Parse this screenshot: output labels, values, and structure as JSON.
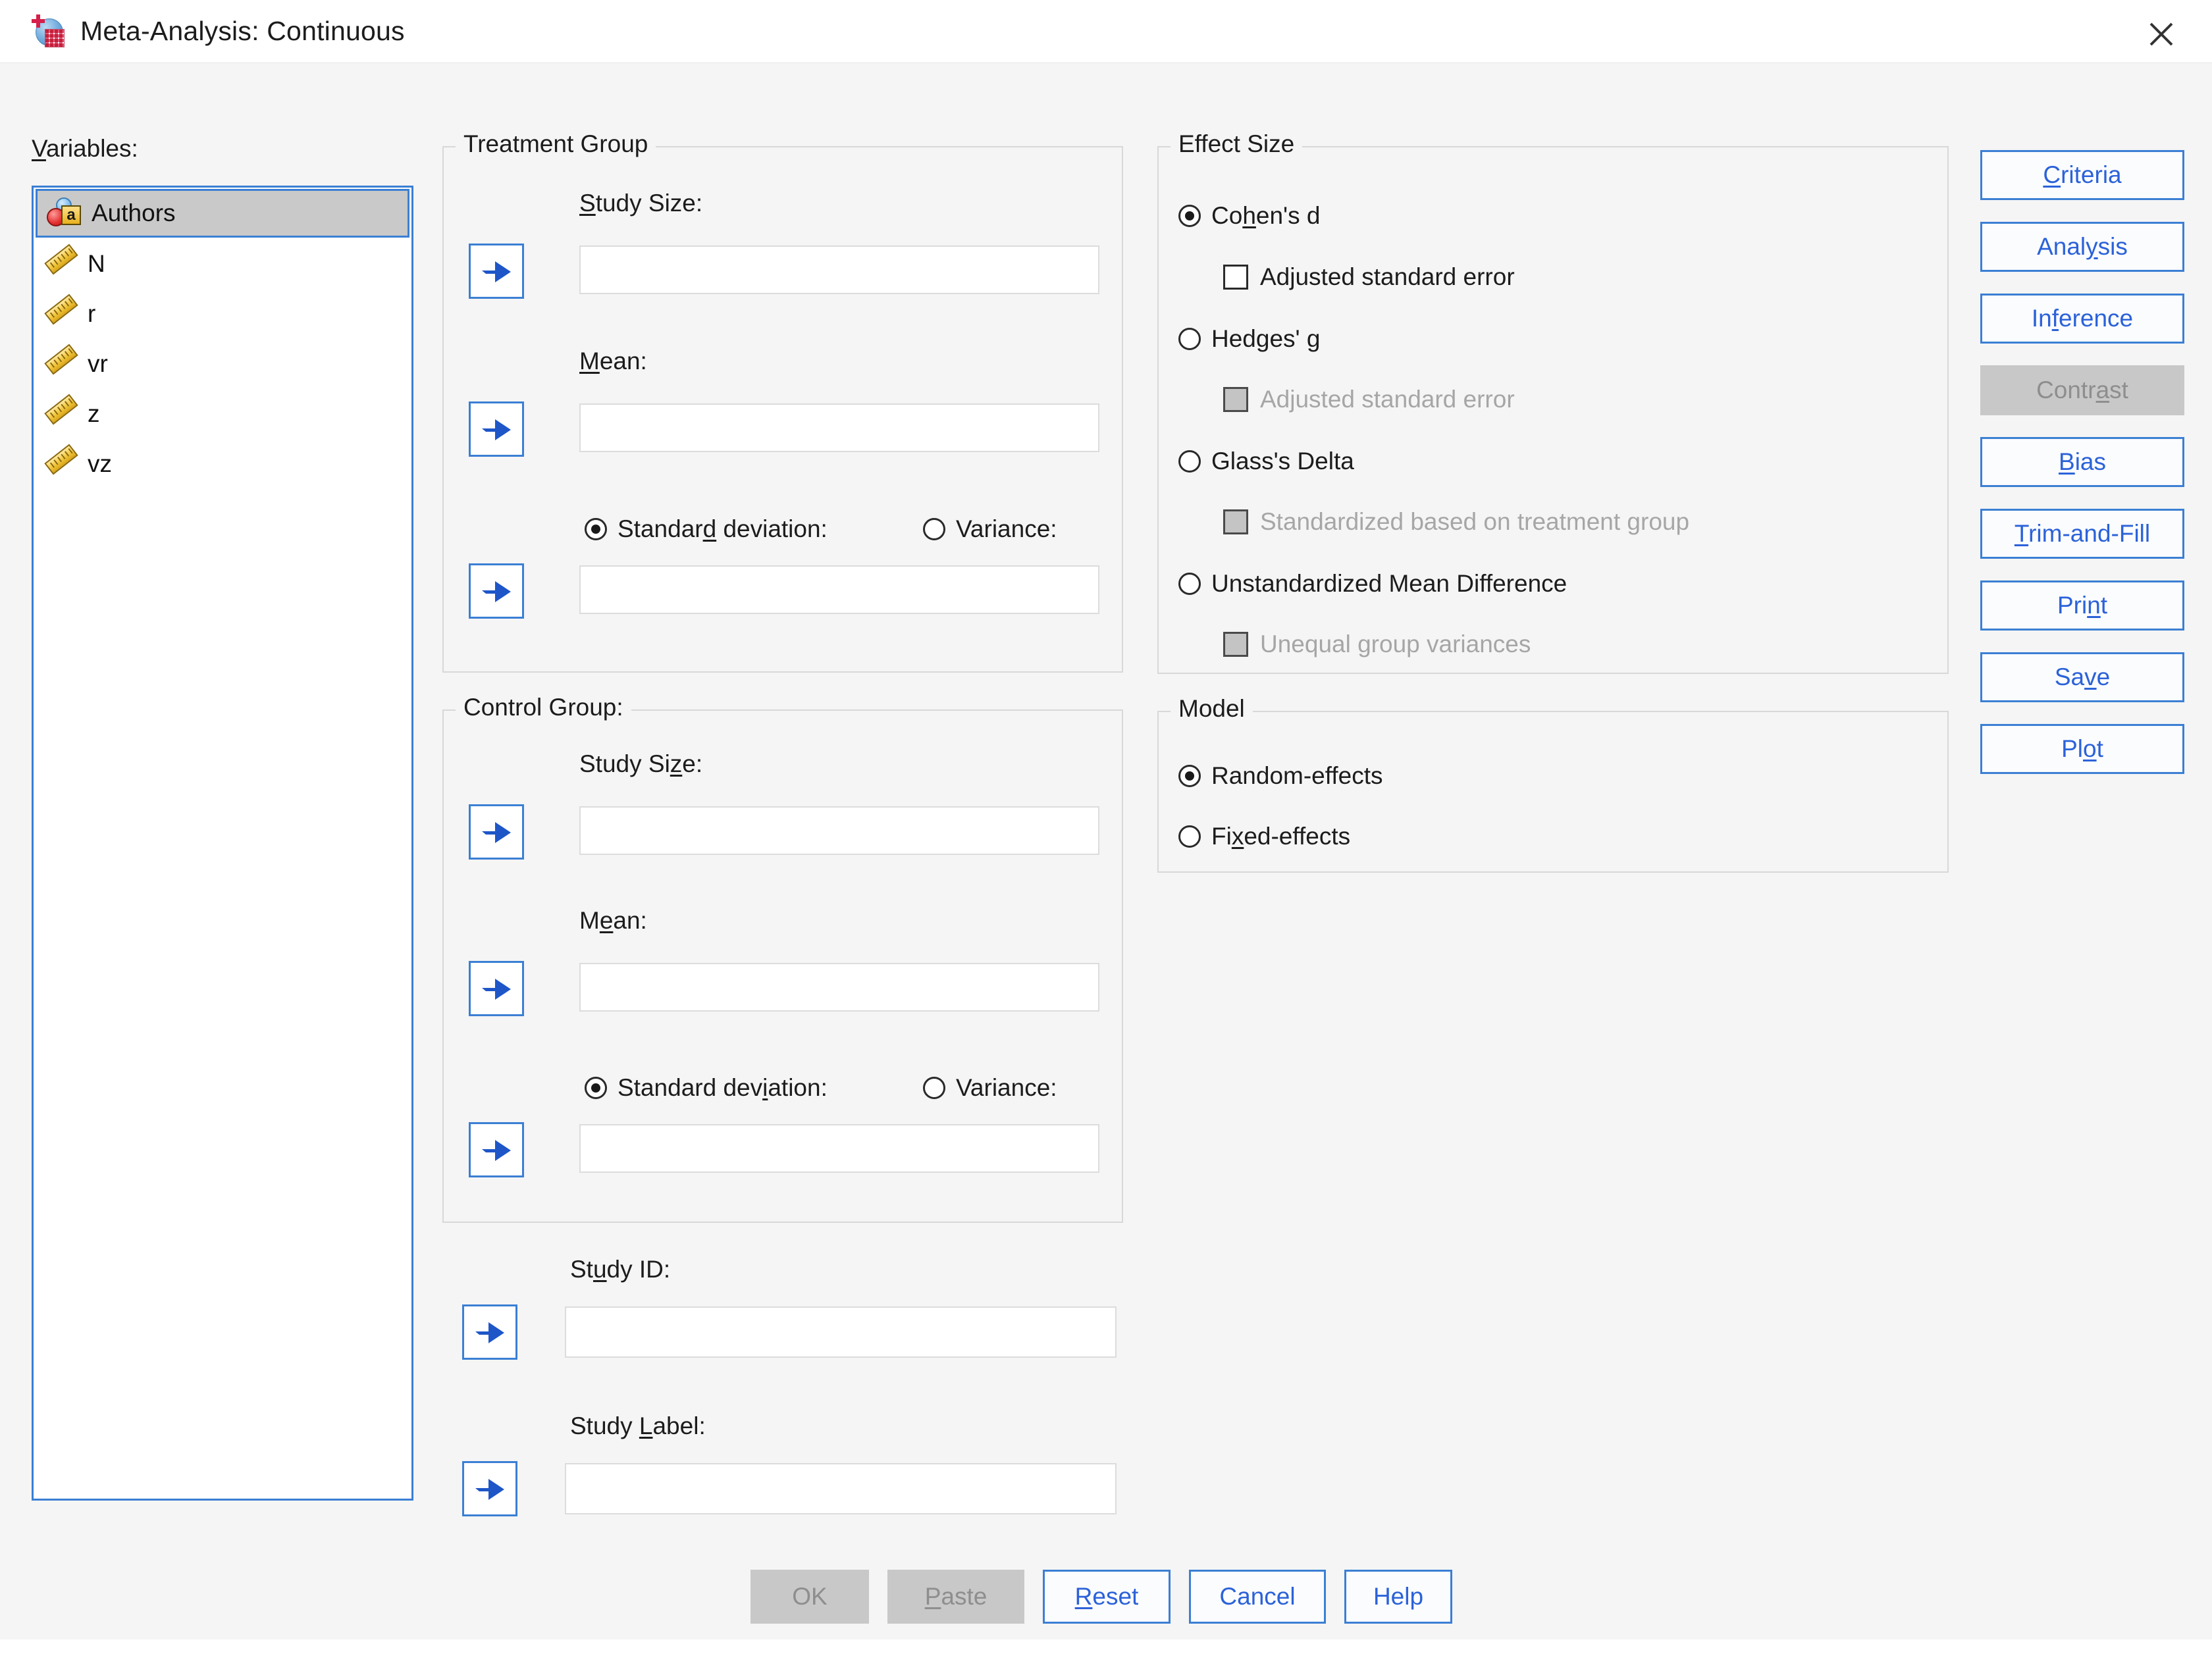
{
  "window": {
    "title": "Meta-Analysis: Continuous",
    "icon": "spss-meta-analysis-icon",
    "close_label": "✕"
  },
  "variables": {
    "label": "Variables:",
    "items": [
      {
        "name": "Authors",
        "icon": "nominal-string-icon",
        "selected": true
      },
      {
        "name": "N",
        "icon": "scale-icon",
        "selected": false
      },
      {
        "name": "r",
        "icon": "scale-icon",
        "selected": false
      },
      {
        "name": "vr",
        "icon": "scale-icon",
        "selected": false
      },
      {
        "name": "z",
        "icon": "scale-icon",
        "selected": false
      },
      {
        "name": "vz",
        "icon": "scale-icon",
        "selected": false
      }
    ]
  },
  "treatment_group": {
    "title": "Treatment Group",
    "study_size_label_pre": "S",
    "study_size_label_mn": "t",
    "study_size_label": "Study Size:",
    "mean_label": "Mean:",
    "sd_label": "Standard deviation:",
    "variance_label": "Variance:",
    "sd_selected": true,
    "variance_selected": false,
    "study_size_value": "",
    "mean_value": "",
    "sd_value": "",
    "arrow_icon": "move-right-arrow-icon"
  },
  "control_group": {
    "title": "Control Group:",
    "study_size_label": "Study Size:",
    "mean_label": "Mean:",
    "sd_label": "Standard deviation:",
    "variance_label": "Variance:",
    "sd_selected": true,
    "variance_selected": false,
    "study_size_value": "",
    "mean_value": "",
    "sd_value": "",
    "arrow_icon": "move-right-arrow-icon"
  },
  "study_fields": {
    "study_id_label": "Study ID:",
    "study_id_value": "",
    "study_label_label": "Study Label:",
    "study_label_value": "",
    "arrow_icon": "move-right-arrow-icon"
  },
  "effect_size": {
    "title": "Effect Size",
    "options": [
      {
        "label": "Cohen's d",
        "selected": true,
        "sub_label": "Adjusted standard error",
        "sub_checked": false,
        "sub_disabled": false
      },
      {
        "label": "Hedges' g",
        "selected": false,
        "sub_label": "Adjusted standard error",
        "sub_checked": false,
        "sub_disabled": true
      },
      {
        "label": "Glass's Delta",
        "selected": false,
        "sub_label": "Standardized based on treatment group",
        "sub_checked": false,
        "sub_disabled": true
      },
      {
        "label": "Unstandardized Mean Difference",
        "selected": false,
        "sub_label": "Unequal group variances",
        "sub_checked": false,
        "sub_disabled": true
      }
    ]
  },
  "model": {
    "title": "Model",
    "options": [
      {
        "label": "Random-effects",
        "selected": true
      },
      {
        "label": "Fixed-effects",
        "selected": false
      }
    ]
  },
  "side_buttons": [
    {
      "label": "Criteria",
      "disabled": false
    },
    {
      "label": "Analysis",
      "disabled": false
    },
    {
      "label": "Inference",
      "disabled": false
    },
    {
      "label": "Contrast",
      "disabled": true
    },
    {
      "label": "Bias",
      "disabled": false
    },
    {
      "label": "Trim-and-Fill",
      "disabled": false
    },
    {
      "label": "Print",
      "disabled": false
    },
    {
      "label": "Save",
      "disabled": false
    },
    {
      "label": "Plot",
      "disabled": false
    }
  ],
  "bottom_buttons": [
    {
      "label": "OK",
      "disabled": true
    },
    {
      "label": "Paste",
      "disabled": true
    },
    {
      "label": "Reset",
      "disabled": false
    },
    {
      "label": "Cancel",
      "disabled": false
    },
    {
      "label": "Help",
      "disabled": false
    }
  ],
  "colors": {
    "accent_blue": "#3b7fd4",
    "link_blue": "#2b62d9",
    "dialog_bg": "#f5f5f5",
    "disabled_gray": "#c8c8c8",
    "selection_gray": "#c9c9c9"
  }
}
